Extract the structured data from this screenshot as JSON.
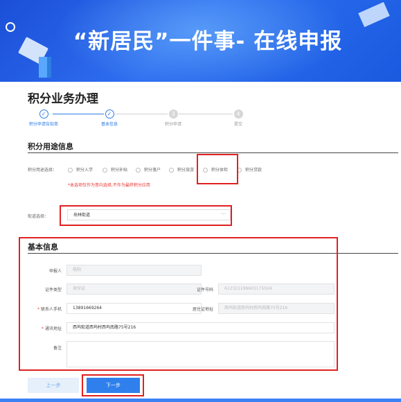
{
  "banner": {
    "title": "“新居民”一件事- 在线申报"
  },
  "page": {
    "title": "积分业务办理"
  },
  "steps": [
    {
      "label": "积分申请告知单",
      "status": "done",
      "marker": "✓"
    },
    {
      "label": "基本信息",
      "status": "done",
      "marker": "✓"
    },
    {
      "label": "积分申请",
      "status": "todo",
      "marker": "3"
    },
    {
      "label": "提交",
      "status": "todo",
      "marker": "4"
    }
  ],
  "usage": {
    "section_title": "积分用途信息",
    "row_label": "积分用途选择：",
    "options": [
      "积分入学",
      "积分补贴",
      "积分落户",
      "积分旅游",
      "积分体检",
      "积分贷款"
    ],
    "hint": "*本选项仅作为意向选择,不作为最终积分应用"
  },
  "street": {
    "label": "街道选择：",
    "value": "岳林街道"
  },
  "basic": {
    "section_title": "基本信息",
    "applicant_label": "申报人",
    "applicant_value": "杨阳",
    "id_type_label": "证件类型",
    "id_type_value": "身份证",
    "id_no_label": "证件号码",
    "id_no_value": "612321199605175024",
    "phone_label": "联系人手机",
    "phone_value": "13891669264",
    "residence_label": "居住证地址",
    "residence_value": "西坞街道西坞村西坞南路75号216",
    "mail_label": "通讯地址",
    "mail_value": "西坞街道西坞村西坞南路75号216",
    "remark_label": "备注",
    "required_mark": "*"
  },
  "actions": {
    "prev": "上一步",
    "next": "下一步"
  },
  "colors": {
    "accent": "#2f80ed",
    "highlight": "#e02020",
    "hint": "#e53935"
  }
}
